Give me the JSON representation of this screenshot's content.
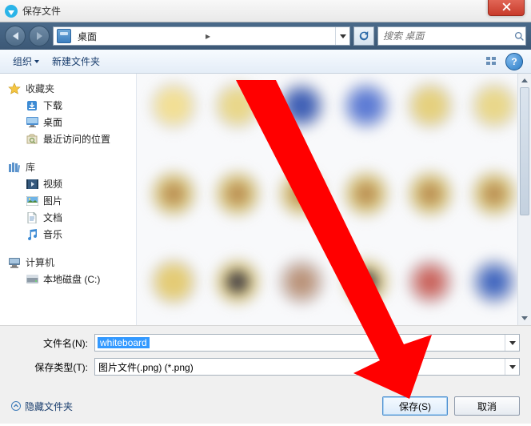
{
  "title": "保存文件",
  "nav": {
    "location_icon": "desktop-icon",
    "location_label": "桌面",
    "search_placeholder": "搜索 桌面"
  },
  "toolbar": {
    "organize": "组织",
    "new_folder": "新建文件夹"
  },
  "sidebar": {
    "favorites": {
      "label": "收藏夹",
      "items": [
        {
          "icon": "download-icon",
          "label": "下载"
        },
        {
          "icon": "desktop-icon",
          "label": "桌面"
        },
        {
          "icon": "recent-icon",
          "label": "最近访问的位置"
        }
      ]
    },
    "libraries": {
      "label": "库",
      "items": [
        {
          "icon": "video-icon",
          "label": "视频"
        },
        {
          "icon": "picture-icon",
          "label": "图片"
        },
        {
          "icon": "document-icon",
          "label": "文档"
        },
        {
          "icon": "music-icon",
          "label": "音乐"
        }
      ]
    },
    "computer": {
      "label": "计算机",
      "items": [
        {
          "icon": "drive-icon",
          "label": "本地磁盘 (C:)"
        }
      ]
    }
  },
  "fields": {
    "filename_label": "文件名(N):",
    "filename_value": "whiteboard",
    "type_label": "保存类型(T):",
    "type_value": "图片文件(.png) (*.png)"
  },
  "footer": {
    "hide_folders": "隐藏文件夹",
    "save": "保存(S)",
    "cancel": "取消"
  }
}
